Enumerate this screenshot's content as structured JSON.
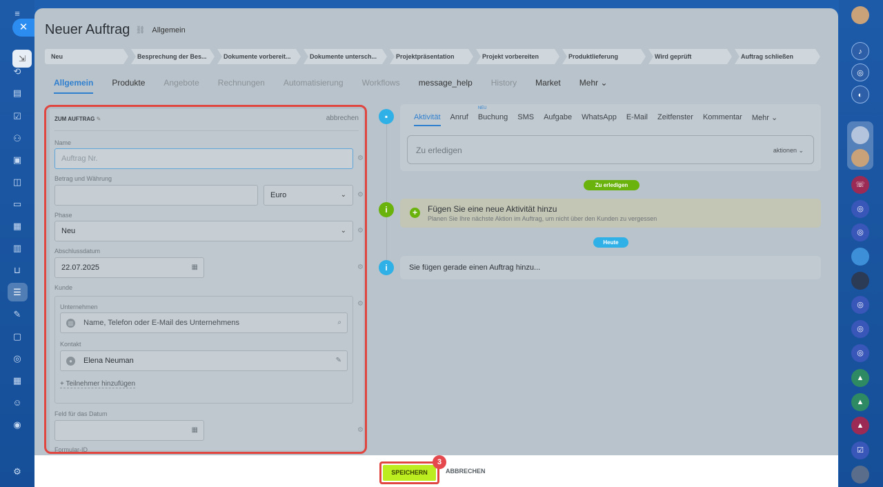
{
  "header": {
    "title": "Neuer Auftrag",
    "subtitle": "Allgemein"
  },
  "stages": [
    "Neu",
    "Besprechung der Bes...",
    "Dokumente vorbereit...",
    "Dokumente untersch...",
    "Projektpräsentation",
    "Projekt vorbereiten",
    "Produktlieferung",
    "Wird geprüft",
    "Auftrag schließen"
  ],
  "tabs": [
    {
      "label": "Allgemein",
      "state": "active"
    },
    {
      "label": "Produkte",
      "state": "dark"
    },
    {
      "label": "Angebote",
      "state": "muted"
    },
    {
      "label": "Rechnungen",
      "state": "muted"
    },
    {
      "label": "Automatisierung",
      "state": "muted"
    },
    {
      "label": "Workflows",
      "state": "muted"
    },
    {
      "label": "message_help",
      "state": "dark"
    },
    {
      "label": "History",
      "state": "muted"
    },
    {
      "label": "Market",
      "state": "dark"
    },
    {
      "label": "Mehr ⌄",
      "state": "dark"
    }
  ],
  "form": {
    "section_title": "ZUM AUFTRAG",
    "cancel_label": "abbrechen",
    "name_label": "Name",
    "name_placeholder": "Auftrag Nr.",
    "amount_label": "Betrag und Währung",
    "amount_value": "",
    "currency_value": "Euro",
    "phase_label": "Phase",
    "phase_value": "Neu",
    "date_label": "Abschlussdatum",
    "date_value": "22.07.2025",
    "customer_label": "Kunde",
    "company_label": "Unternehmen",
    "company_placeholder": "Name, Telefon oder E-Mail des Unternehmens",
    "contact_label": "Kontakt",
    "contact_value": "Elena Neuman",
    "add_participant": "+ Teilnehmer hinzufügen",
    "datefield_label": "Feld für das Datum",
    "formid_label": "Formular-ID"
  },
  "activity": {
    "tabs": [
      {
        "label": "Aktivität",
        "active": true
      },
      {
        "label": "Anruf"
      },
      {
        "label": "Buchung",
        "badge": "NEU"
      },
      {
        "label": "SMS"
      },
      {
        "label": "Aufgabe"
      },
      {
        "label": "WhatsApp"
      },
      {
        "label": "E-Mail"
      },
      {
        "label": "Zeitfenster"
      },
      {
        "label": "Kommentar"
      },
      {
        "label": "Mehr ⌄"
      }
    ],
    "todo_placeholder": "Zu erledigen",
    "todo_action": "aktionen ⌄",
    "todo_pill": "Zu erledigen",
    "hint_title": "Fügen Sie eine neue Aktivität hinzu",
    "hint_sub": "Planen Sie Ihre nächste Aktion im Auftrag, um nicht über den Kunden zu vergessen",
    "today_pill": "Heute",
    "note_text": "Sie fügen gerade einen Auftrag hinzu..."
  },
  "footer": {
    "save_label": "SPEICHERN",
    "cancel_label": "ABBRECHEN",
    "step_badge": "3"
  },
  "colors": {
    "accent": "#2f7fcf",
    "save": "#bbed21",
    "highlight": "#e0453f",
    "green_pill": "#6ab20c",
    "blue_pill": "#2fb0e6"
  }
}
